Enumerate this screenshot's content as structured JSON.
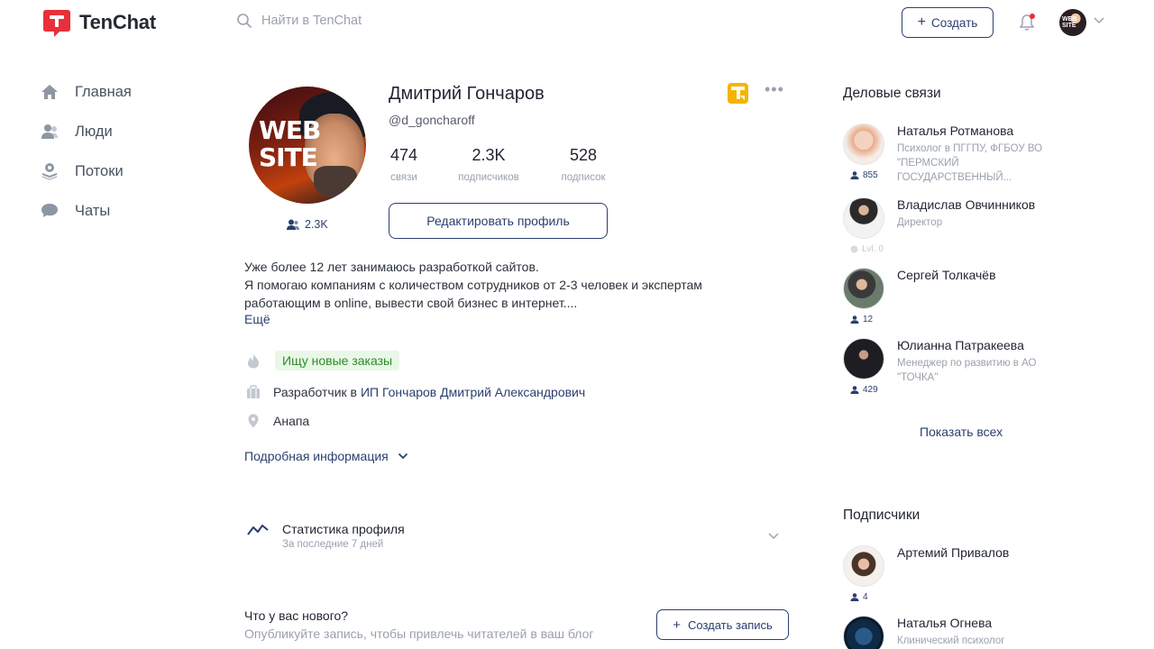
{
  "header": {
    "brand": "TenChat",
    "search_placeholder": "Найти в TenChat",
    "create_label": "Создать"
  },
  "nav": {
    "items": [
      {
        "label": "Главная",
        "icon": "home-icon"
      },
      {
        "label": "Люди",
        "icon": "people-icon"
      },
      {
        "label": "Потоки",
        "icon": "streams-icon"
      },
      {
        "label": "Чаты",
        "icon": "chat-icon"
      }
    ]
  },
  "profile": {
    "avatar_text": "WEB SITE",
    "name": "Дмитрий Гончаров",
    "handle": "@d_goncharoff",
    "followers_short": "2.3K",
    "stats": [
      {
        "value": "474",
        "label": "связи"
      },
      {
        "value": "2.3K",
        "label": "подписчиков"
      },
      {
        "value": "528",
        "label": "подписок"
      }
    ],
    "edit_label": "Редактировать профиль",
    "about": [
      "Уже более 12 лет занимаюсь разработкой сайтов.",
      "Я помогаю компаниям с количеством сотрудников от 2-3 человек и экспертам",
      "работающим в online, вывести свой бизнес в интернет...."
    ],
    "more_label": "Ещё",
    "status_tag": "Ищу новые заказы",
    "job_prefix": "Разработчик в",
    "job_company": "ИП Гончаров Дмитрий Александрович",
    "city": "Анапа",
    "details_label": "Подробная информация"
  },
  "stats_block": {
    "title": "Статистика профиля",
    "subtitle": "За последние 7 дней"
  },
  "new_post": {
    "title": "Что у вас нового?",
    "subtitle": "Опубликуйте запись, чтобы привлечь читателей в ваш блог",
    "button_label": "Создать запись"
  },
  "connections": {
    "title": "Деловые связи",
    "people": [
      {
        "name": "Наталья Ротманова",
        "role": "Психолог в ПГГПУ, ФГБОУ ВО \"ПЕРМСКИЙ ГОСУДАРСТВЕННЫЙ...",
        "count": "855"
      },
      {
        "name": "Владислав Овчинников",
        "role": "Директор",
        "count": "Lvl. 0"
      },
      {
        "name": "Сергей Толкачёв",
        "role": "",
        "count": "12"
      },
      {
        "name": "Юлианна Патракеева",
        "role": "Менеджер по развитию в АО \"ТОЧКА\"",
        "count": "429"
      }
    ],
    "show_all": "Показать всех"
  },
  "subscribers": {
    "title": "Подписчики",
    "people": [
      {
        "name": "Артемий Привалов",
        "role": "",
        "count": "4"
      },
      {
        "name": "Наталья Огнева",
        "role": "Клинический психолог",
        "count": ""
      }
    ]
  },
  "colors": {
    "accent": "#2b3f6e",
    "brand_red": "#e8303a",
    "tag_green_bg": "#e9f8e6",
    "tag_green_text": "#2f8a2a",
    "badge_yellow": "#f4b400"
  }
}
